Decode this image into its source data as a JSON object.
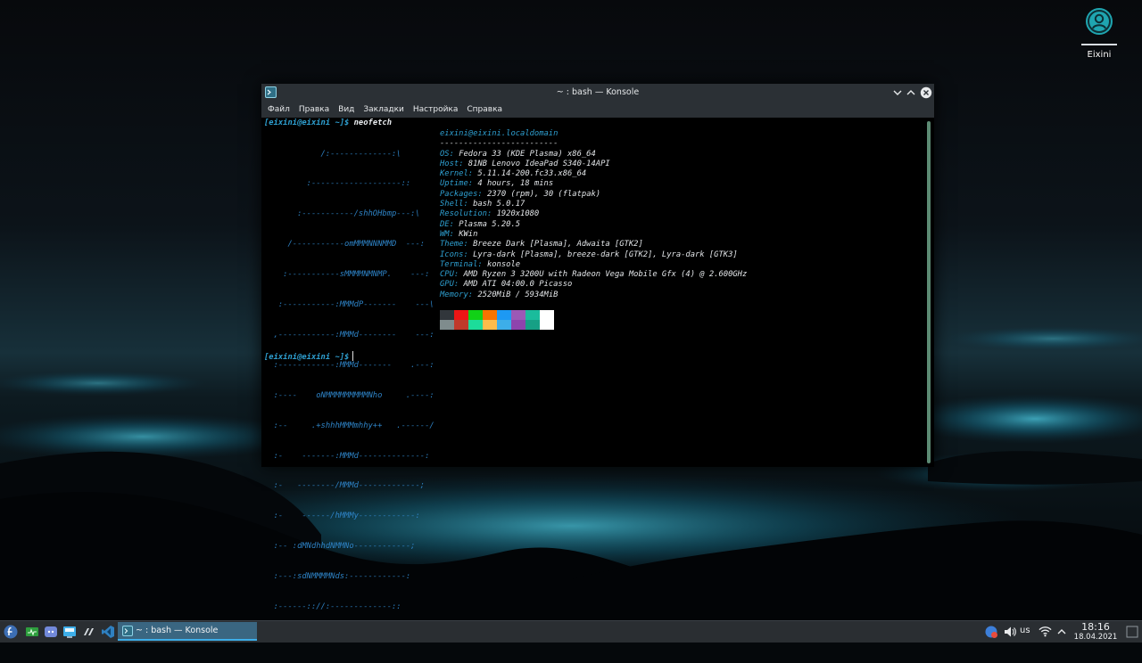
{
  "desktop": {
    "user_icon_label": "Eixini"
  },
  "window": {
    "title": "~ : bash — Konsole",
    "menu": [
      "Файл",
      "Правка",
      "Вид",
      "Закладки",
      "Настройка",
      "Справка"
    ]
  },
  "terminal": {
    "prompt1": "[eixini@eixini ~]$",
    "command1": " neofetch",
    "prompt2": "[eixini@eixini ~]$",
    "logo_lines": [
      "            /:-------------:\\",
      "         :-------------------::",
      "       :-----------/shhOHbmp---:\\",
      "     /-----------omMMMNNNMMD  ---:",
      "    :-----------sMMMMNMNMP.    ---:",
      "   :-----------:MMMdP-------    ---\\",
      "  ,------------:MMMd--------    ---:",
      "  :------------:MMMd-------    .---:",
      "  :----    oNMMMMMMMMMNho     .----:",
      "  :--     .+shhhMMMmhhy++   .------/",
      "  :-    -------:MMMd--------------:",
      "  :-   --------/MMMd-------------;",
      "  :-    ------/hMMMy------------:",
      "  :-- :dMNdhhdNMMNo------------;",
      "  :---:sdNMMMMNds:------------:",
      "  :------:://:-------------::",
      "  :---------------------://"
    ],
    "user_host": "eixini@eixini.localdomain",
    "separator": "-------------------------",
    "info": [
      {
        "key": "OS",
        "value": "Fedora 33 (KDE Plasma) x86_64"
      },
      {
        "key": "Host",
        "value": "81NB Lenovo IdeaPad S340-14API"
      },
      {
        "key": "Kernel",
        "value": "5.11.14-200.fc33.x86_64"
      },
      {
        "key": "Uptime",
        "value": "4 hours, 18 mins"
      },
      {
        "key": "Packages",
        "value": "2370 (rpm), 30 (flatpak)"
      },
      {
        "key": "Shell",
        "value": "bash 5.0.17"
      },
      {
        "key": "Resolution",
        "value": "1920x1080"
      },
      {
        "key": "DE",
        "value": "Plasma 5.20.5"
      },
      {
        "key": "WM",
        "value": "KWin"
      },
      {
        "key": "Theme",
        "value": "Breeze Dark [Plasma], Adwaita [GTK2]"
      },
      {
        "key": "Icons",
        "value": "Lyra-dark [Plasma], breeze-dark [GTK2], Lyra-dark [GTK3]"
      },
      {
        "key": "Terminal",
        "value": "konsole"
      },
      {
        "key": "CPU",
        "value": "AMD Ryzen 3 3200U with Radeon Vega Mobile Gfx (4) @ 2.600GHz"
      },
      {
        "key": "GPU",
        "value": "AMD ATI 04:00.0 Picasso"
      },
      {
        "key": "Memory",
        "value": "2520MiB / 5934MiB"
      }
    ],
    "palette_top": [
      "#31363b",
      "#ed1515",
      "#11d116",
      "#f67400",
      "#1d99f3",
      "#9b59b6",
      "#1abc9c",
      "#ffffff"
    ],
    "palette_bottom": [
      "#7f8c8d",
      "#c0392b",
      "#1cdc9a",
      "#fdbc4b",
      "#3daee9",
      "#8e44ad",
      "#16a085",
      "#ffffff"
    ]
  },
  "taskbar": {
    "task_label": "~ : bash — Konsole",
    "keyboard_layout": "us",
    "time": "18:16",
    "date": "18.04.2021"
  },
  "colors": {
    "accent": "#3daee9",
    "panel": "#2a2e32",
    "titlebar": "#2b3035"
  }
}
